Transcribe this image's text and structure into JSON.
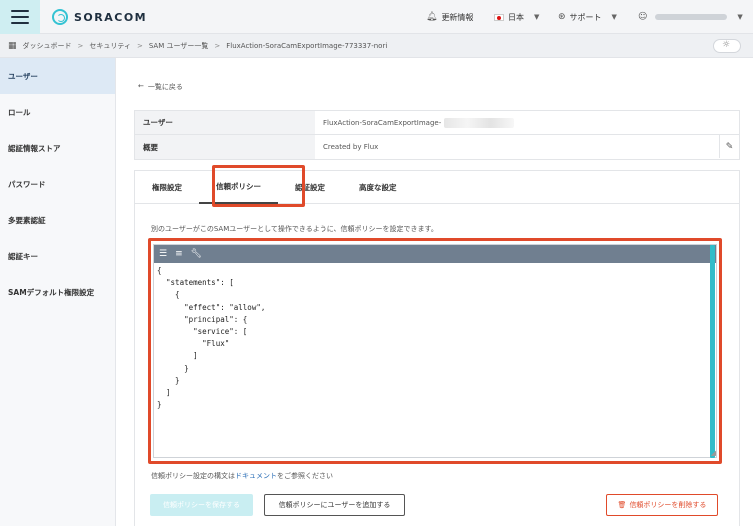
{
  "header": {
    "logo": "SORACOM",
    "updates": "更新情報",
    "language": "日本",
    "support": "サポート"
  },
  "breadcrumb": [
    "ダッシュボード",
    "セキュリティ",
    "SAM ユーザー一覧",
    "FluxAction-SoraCamExportImage-773337-nori"
  ],
  "sidebar": {
    "items": [
      "ユーザー",
      "ロール",
      "認証情報ストア",
      "パスワード",
      "多要素認証",
      "認証キー",
      "SAMデフォルト権限設定"
    ]
  },
  "main": {
    "back": "一覧に戻る",
    "user_label": "ユーザー",
    "user_value": "FluxAction-SoraCamExportImage-",
    "summary_label": "概要",
    "summary_value": "Created by Flux",
    "tabs": [
      "権限設定",
      "信頼ポリシー",
      "認証設定",
      "高度な設定"
    ],
    "description": "別のユーザーがこのSAMユーザーとして操作できるように、信頼ポリシーを設定できます。",
    "policy_json": "{\n  \"statements\": [\n    {\n      \"effect\": \"allow\",\n      \"principal\": {\n        \"service\": [\n          \"Flux\"\n        ]\n      }\n    }\n  ]\n}",
    "doc_prefix": "信頼ポリシー設定の構文は",
    "doc_link": "ドキュメント",
    "doc_suffix": "をご参照ください",
    "save_button": "信頼ポリシーを保存する",
    "add_user_button": "信頼ポリシーにユーザーを追加する",
    "delete_button": "信頼ポリシーを削除する"
  },
  "icons": {
    "menu": "hamburger-icon",
    "bell": "bell-icon",
    "support": "lifebuoy-icon",
    "user": "user-icon",
    "dashboard": "grid-icon",
    "edit": "pencil-icon",
    "trash": "trash-icon"
  },
  "colors": {
    "accent": "#34c3d3",
    "highlight": "#e04a2a",
    "active_nav": "#dde9f5"
  }
}
